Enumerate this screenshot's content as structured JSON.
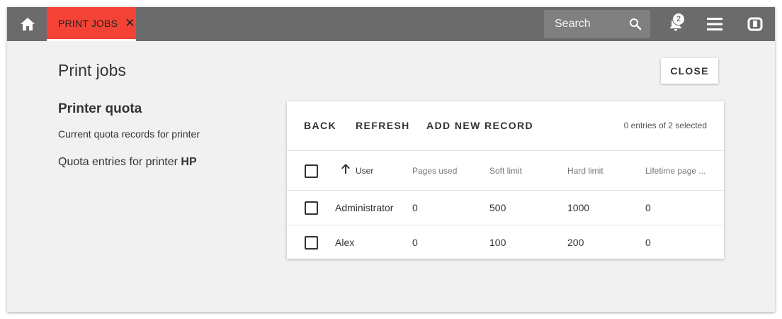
{
  "tab": {
    "label": "PRINT JOBS",
    "close_glyph": "✕"
  },
  "search": {
    "placeholder": "Search"
  },
  "notifications": {
    "count": "2"
  },
  "page": {
    "title": "Print jobs",
    "close_label": "CLOSE"
  },
  "section": {
    "title": "Printer quota",
    "description": "Current quota records for printer",
    "quota_prefix": "Quota entries for printer ",
    "printer_name": "HP"
  },
  "toolbar": {
    "back_label": "BACK",
    "refresh_label": "REFRESH",
    "add_label": "ADD NEW RECORD",
    "selection_text": "0 entries of 2 selected"
  },
  "table": {
    "columns": [
      "User",
      "Pages used",
      "Soft limit",
      "Hard limit",
      "Lifetime page ..."
    ],
    "sort": {
      "column": "User",
      "direction": "ascending"
    },
    "rows": [
      {
        "user": "Administrator",
        "pages_used": "0",
        "soft_limit": "500",
        "hard_limit": "1000",
        "lifetime": "0",
        "selected": false
      },
      {
        "user": "Alex",
        "pages_used": "0",
        "soft_limit": "100",
        "hard_limit": "200",
        "lifetime": "0",
        "selected": false
      }
    ]
  },
  "icons": [
    "home-icon",
    "close-icon",
    "search-icon",
    "bell-icon",
    "menu-icon",
    "app-icon",
    "arrow-up-icon"
  ],
  "colors": {
    "topbar": "#6b6b6b",
    "active_tab": "#f44336",
    "background": "#f1f1f1",
    "card": "#ffffff"
  }
}
